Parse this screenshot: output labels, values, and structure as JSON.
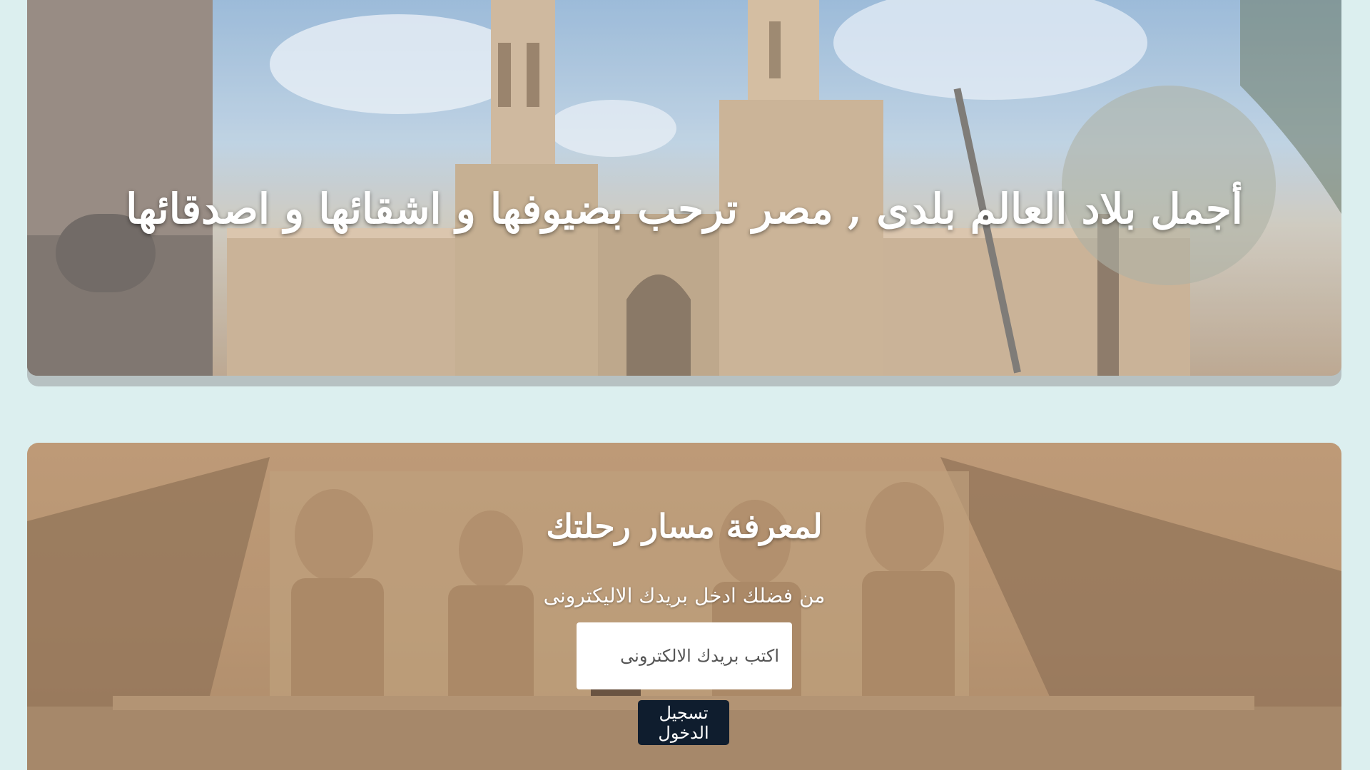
{
  "hero": {
    "title": "أجمل بلاد العالم بلدى , مصر ترحب بضيوفها و اشقائها و اصدقائها",
    "image": "cairo-citadel-gate-image"
  },
  "trip": {
    "title": "لمعرفة مسار رحلتك",
    "subtitle": "من فضلك ادخل بريدك الاليكترونى",
    "email_placeholder": "اكتب بريدك الالكترونى",
    "email_value": "",
    "login_label": "تسجيل الدخول",
    "image": "abu-simbel-temple-image"
  },
  "colors": {
    "page_background": "#dcefef",
    "button_background": "#0f1d2e",
    "heading_text": "#ffffff"
  }
}
